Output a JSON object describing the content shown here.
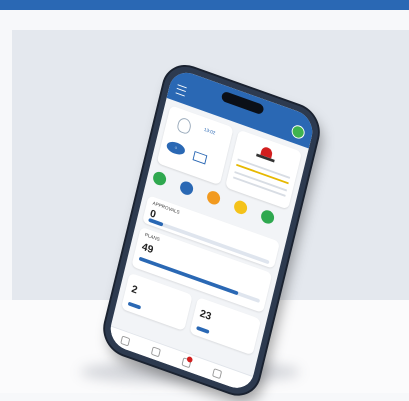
{
  "app": {
    "title": "",
    "header": {
      "brand_color": "#2a68b4"
    },
    "icons": {
      "menu": "menu-icon",
      "profile": "avatar"
    },
    "cards": {
      "attendance": {
        "time_label": "13:02"
      },
      "emergency": {
        "icon": "siren-icon"
      }
    },
    "shortcuts": [
      {
        "color": "#2fa84f",
        "icon": "shortcut-icon"
      },
      {
        "color": "#2a68b4",
        "icon": "shortcut-icon"
      },
      {
        "color": "#f29a1f",
        "icon": "shortcut-icon"
      },
      {
        "color": "#f4c21a",
        "icon": "shortcut-icon"
      },
      {
        "color": "#2fa84f",
        "icon": "shortcut-icon"
      }
    ],
    "sections": {
      "approvals": {
        "title": "APPROVALS",
        "count": "0",
        "progress": 0.12
      },
      "plans": {
        "title": "PLANS",
        "count": "49",
        "progress": 0.82
      },
      "leave": {
        "left_count": "2",
        "right_count": "23"
      }
    },
    "bottom_nav": [
      "home-icon",
      "list-icon",
      "alert-icon",
      "grid-icon"
    ]
  }
}
